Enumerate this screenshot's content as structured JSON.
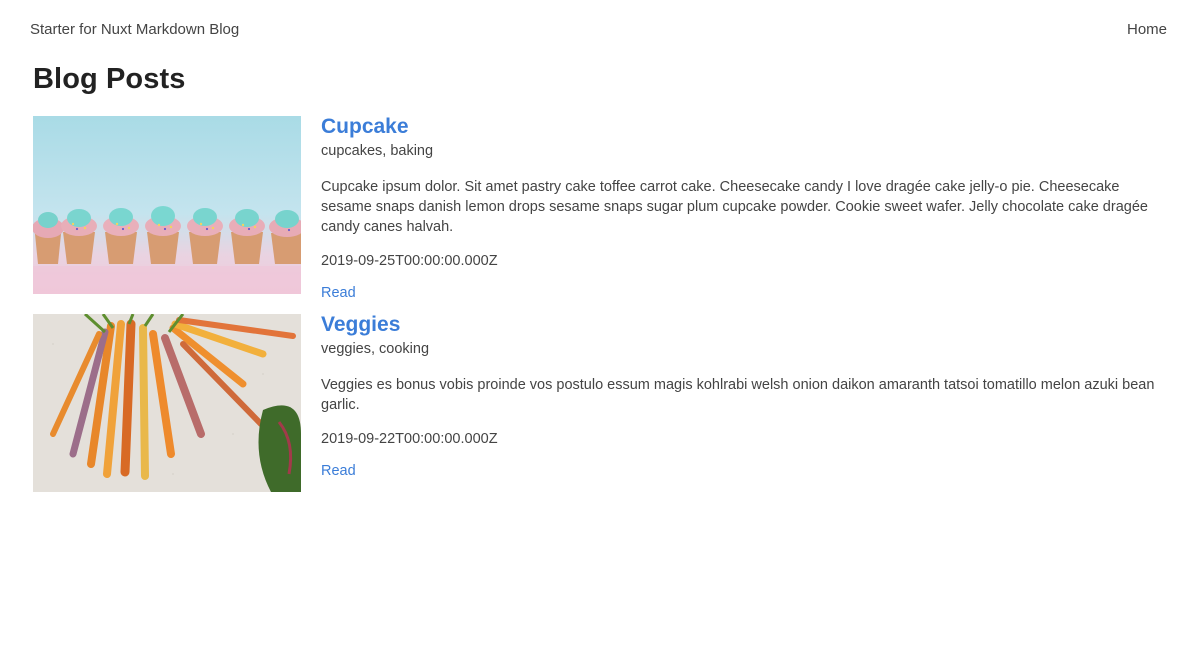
{
  "nav": {
    "brand": "Starter for Nuxt Markdown Blog",
    "home": "Home"
  },
  "page": {
    "title": "Blog Posts"
  },
  "posts": [
    {
      "title": "Cupcake",
      "tags": "cupcakes, baking",
      "description": "Cupcake ipsum dolor. Sit amet pastry cake toffee carrot cake. Cheesecake candy I love dragée cake jelly-o pie. Cheesecake sesame snaps danish lemon drops sesame snaps sugar plum cupcake powder. Cookie sweet wafer. Jelly chocolate cake dragée candy canes halvah.",
      "date": "2019-09-25T00:00:00.000Z",
      "read": "Read"
    },
    {
      "title": "Veggies",
      "tags": "veggies, cooking",
      "description": "Veggies es bonus vobis proinde vos postulo essum magis kohlrabi welsh onion daikon amaranth tatsoi tomatillo melon azuki bean garlic.",
      "date": "2019-09-22T00:00:00.000Z",
      "read": "Read"
    }
  ]
}
